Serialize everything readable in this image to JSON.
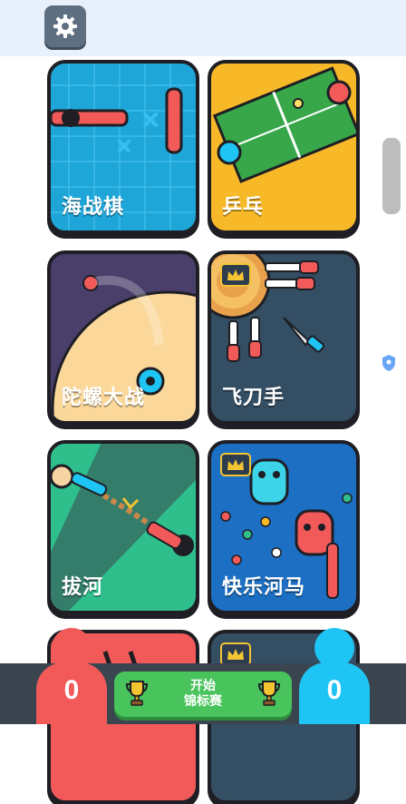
{
  "games": [
    {
      "name": "海战棋",
      "color": "#1ea6d8"
    },
    {
      "name": "乒乓",
      "color": "#f7b928"
    },
    {
      "name": "陀螺大战",
      "color": "#4a3f6b"
    },
    {
      "name": "飞刀手",
      "color": "#344e63"
    },
    {
      "name": "拔河",
      "color": "#2fbf8d"
    },
    {
      "name": "快乐河马",
      "color": "#1c6fc2"
    }
  ],
  "start_button": {
    "line1": "开始",
    "line2": "锦标赛"
  },
  "players": {
    "red": {
      "score": "0",
      "color": "#f25a5a"
    },
    "blue": {
      "score": "0",
      "color": "#1ec5f4"
    }
  },
  "icons": {
    "settings": "gear-icon",
    "shield": "shield-icon",
    "trophy": "trophy-icon",
    "crown": "crown-icon"
  }
}
